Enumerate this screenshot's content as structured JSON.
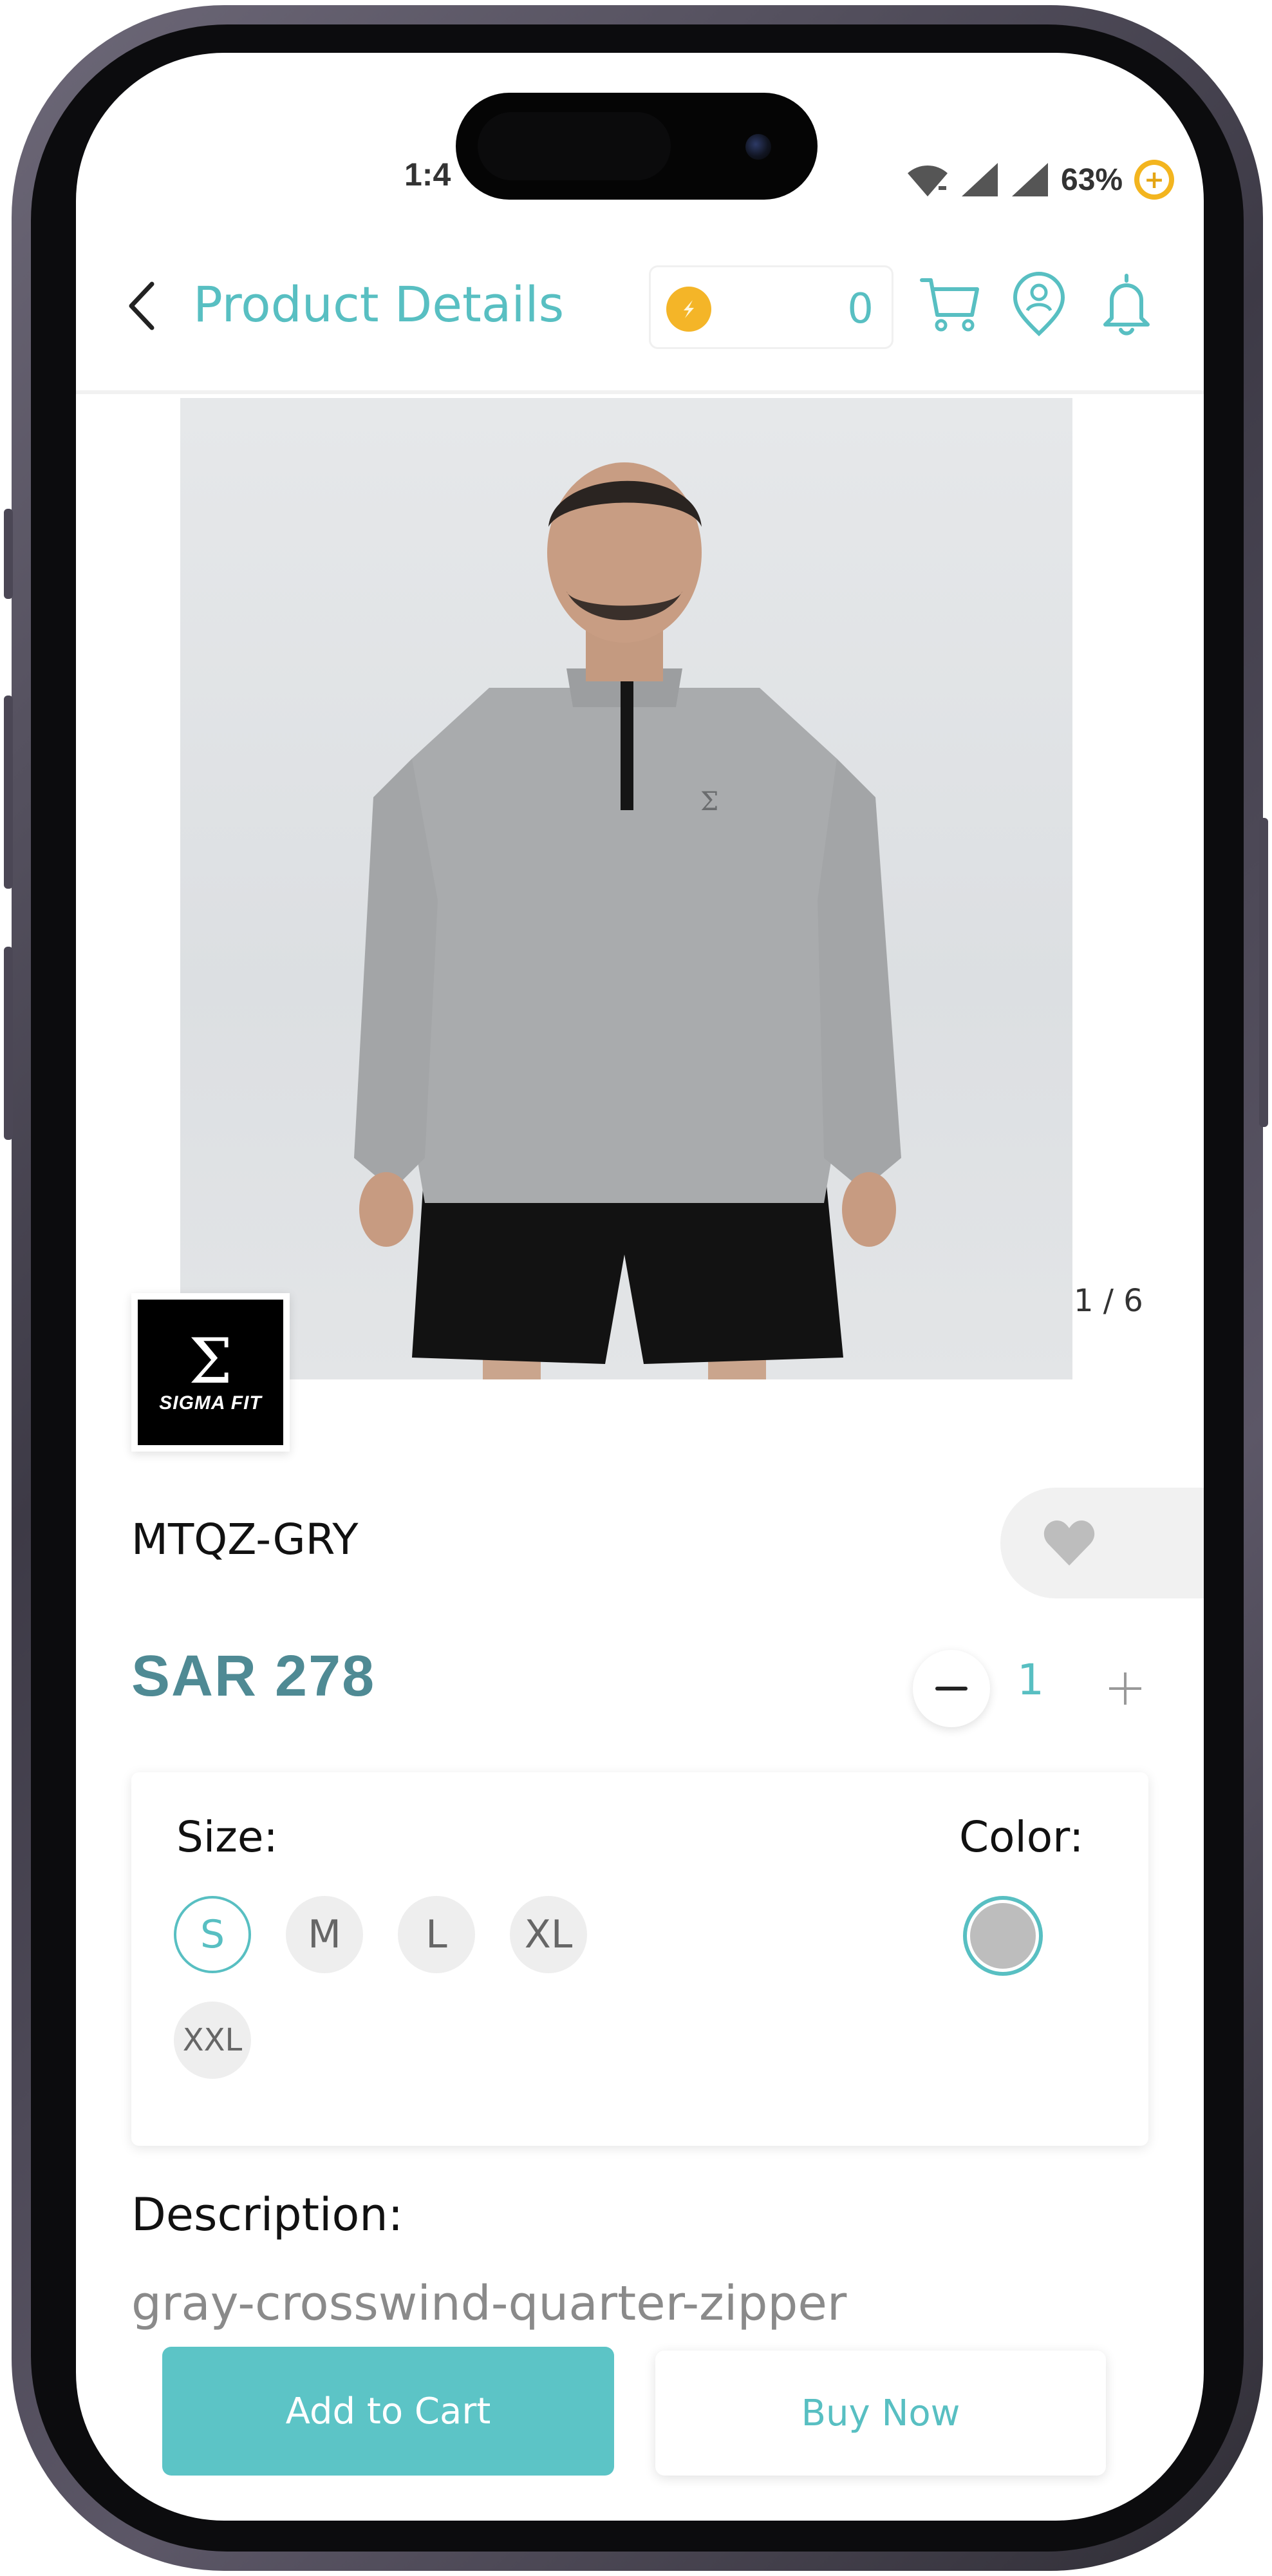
{
  "status_bar": {
    "time": "1:4",
    "battery": "63%"
  },
  "header": {
    "title": "Product Details",
    "points": "0"
  },
  "product": {
    "image_counter": "1 / 6",
    "brand_logo_text": "SIGMA FIT",
    "sku": "MTQZ-GRY",
    "price": "SAR 278",
    "quantity": "1"
  },
  "variants": {
    "size_label": "Size:",
    "sizes": [
      "S",
      "M",
      "L",
      "XL",
      "XXL"
    ],
    "selected_size": "S",
    "color_label": "Color:",
    "colors": [
      "#bdbdbd"
    ]
  },
  "description": {
    "label": "Description:",
    "value": "gray-crosswind-quarter-zipper"
  },
  "actions": {
    "add_to_cart": "Add to Cart",
    "buy_now": "Buy Now"
  },
  "theme": {
    "accent": "#58bfc2",
    "price_color": "#4f8a94",
    "coin": "#f4b528"
  },
  "icons": [
    "chevron-left-icon",
    "coin-icon",
    "cart-icon",
    "location-user-icon",
    "bell-icon",
    "heart-icon",
    "minus-icon",
    "plus-icon",
    "wifi-icon",
    "signal-icon"
  ]
}
